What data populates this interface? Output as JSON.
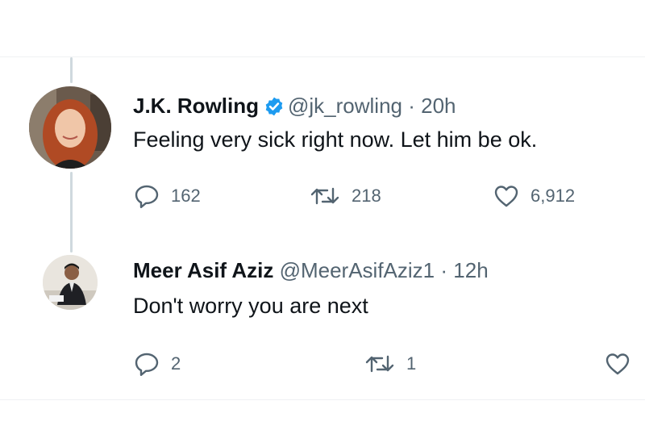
{
  "tweet": {
    "author_name": "J.K. Rowling",
    "handle": "@jk_rowling",
    "separator": "·",
    "time": "20h",
    "text": "Feeling very sick right now. Let him be ok.",
    "replies": "162",
    "retweets": "218",
    "likes": "6,912",
    "verified": true
  },
  "reply": {
    "author_name": "Meer Asif Aziz",
    "handle": "@MeerAsifAziz1",
    "separator": "·",
    "time": "12h",
    "text": "Don't worry you are next",
    "replies": "2",
    "retweets": "1"
  },
  "colors": {
    "verified_blue": "#1d9bf0",
    "secondary_text": "#536471",
    "thread_line": "#cfd9de"
  }
}
